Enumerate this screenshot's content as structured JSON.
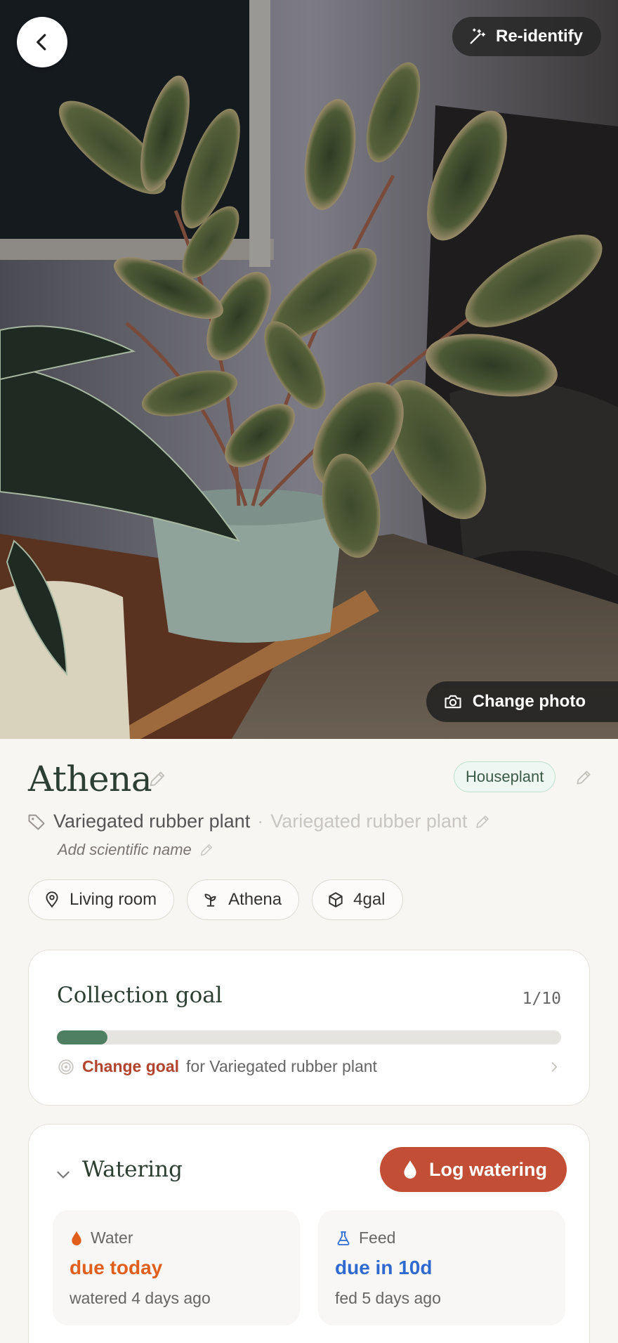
{
  "header": {
    "reidentify_label": "Re-identify",
    "change_photo_label": "Change photo"
  },
  "plant": {
    "name": "Athena",
    "type_tag": "Houseplant",
    "common_name": "Variegated rubber plant",
    "common_name_alt": "Variegated rubber plant",
    "scientific_name_placeholder": "Add scientific name"
  },
  "chips": [
    {
      "icon": "location-pin-icon",
      "label": "Living room"
    },
    {
      "icon": "sprout-icon",
      "label": "Athena"
    },
    {
      "icon": "box-icon",
      "label": "4gal"
    }
  ],
  "collection_goal": {
    "title": "Collection goal",
    "count": "1/10",
    "progress": 0.1,
    "link_label": "Change goal",
    "suffix": "for Variegated rubber plant"
  },
  "watering": {
    "title": "Watering",
    "log_button_label": "Log watering",
    "water": {
      "label": "Water",
      "status": "due today",
      "last": "watered 4 days ago"
    },
    "feed": {
      "label": "Feed",
      "status": "due in 10d",
      "last": "fed 5 days ago"
    }
  },
  "colors": {
    "accent": "#c24f35",
    "progress": "#4e7f62",
    "water_status": "#e05f1c",
    "feed_status": "#2f6ad0"
  }
}
